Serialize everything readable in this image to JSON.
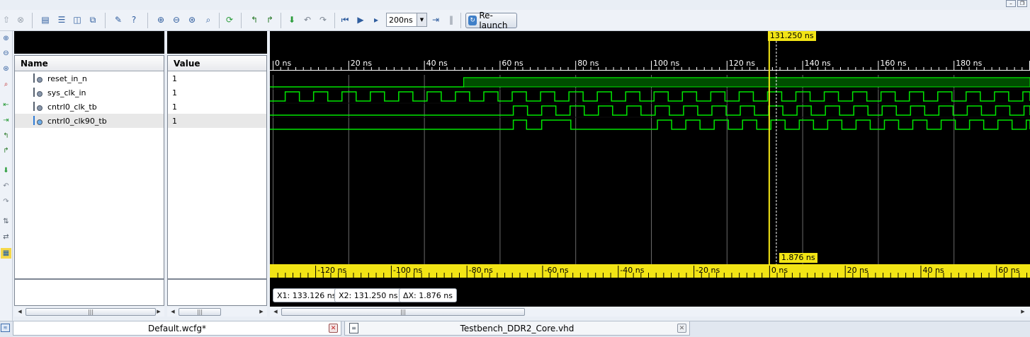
{
  "toolbar": {
    "zoom_value": "200ns",
    "relaunch_label": "Re-launch"
  },
  "panels": {
    "name_header": "Name",
    "value_header": "Value"
  },
  "signals": [
    {
      "name": "reset_in_n",
      "value": "1"
    },
    {
      "name": "sys_clk_in",
      "value": "1"
    },
    {
      "name": "cntrl0_clk_tb",
      "value": "1"
    },
    {
      "name": "cntrl0_clk90_tb",
      "value": "1"
    }
  ],
  "timeline": {
    "ruler_unit": "ns",
    "ruler_max": 200,
    "ruler_ticks": [
      "0 ns",
      "20 ns",
      "40 ns",
      "60 ns",
      "80 ns",
      "100 ns",
      "120 ns",
      "140 ns",
      "160 ns",
      "180 ns"
    ],
    "relative_ticks": [
      "-120 ns",
      "-100 ns",
      "-80 ns",
      "-60 ns",
      "-40 ns",
      "-20 ns",
      "0 ns",
      "20 ns",
      "40 ns",
      "60 ns"
    ]
  },
  "cursors": {
    "main_label": "131.250 ns",
    "main_time": 131.25,
    "secondary_time": 133.126,
    "delta_label": "1.876 ns"
  },
  "measurements": {
    "x1": "X1: 133.126 ns",
    "x2": "X2: 131.250 ns",
    "dx": "ΔX: 1.876 ns"
  },
  "colors": {
    "wave": "#00e600",
    "bus_fill": "#004d00",
    "cursor": "#f2e415",
    "grid": "#6a6a6a"
  },
  "tabs": [
    {
      "label": "Default.wcfg*"
    },
    {
      "label": "Testbench_DDR2_Core.vhd"
    }
  ]
}
